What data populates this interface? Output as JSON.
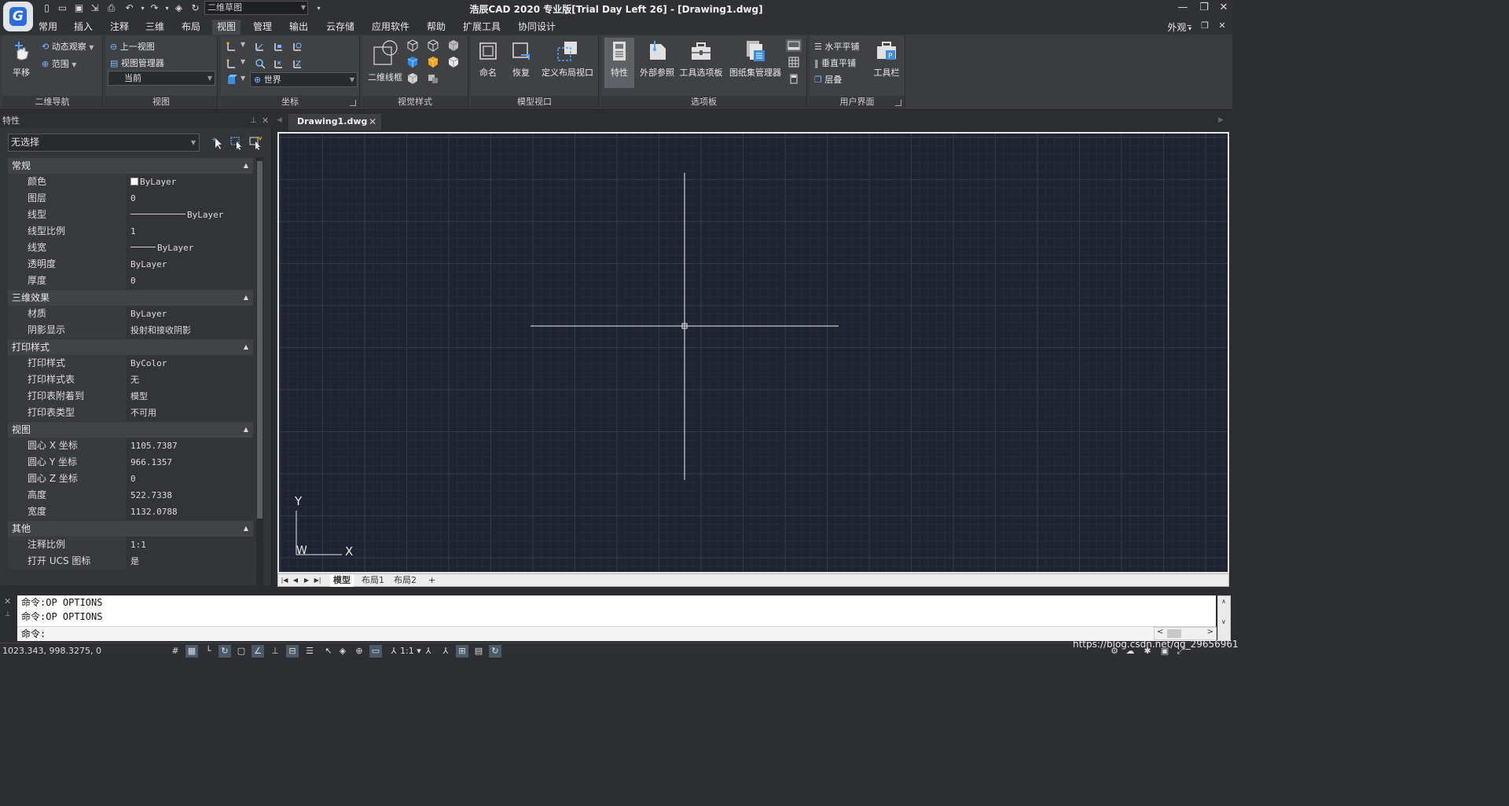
{
  "titlebar": {
    "workspace": "二维草图",
    "title": "浩辰CAD 2020 专业版[Trial Day Left 26] - [Drawing1.dwg]",
    "minimize": "—",
    "restore": "❐",
    "close": "✕"
  },
  "menubar": {
    "items": [
      {
        "label": "常用"
      },
      {
        "label": "插入"
      },
      {
        "label": "注释"
      },
      {
        "label": "三维"
      },
      {
        "label": "布局"
      },
      {
        "label": "视图"
      },
      {
        "label": "管理"
      },
      {
        "label": "输出"
      },
      {
        "label": "云存储"
      },
      {
        "label": "应用软件"
      },
      {
        "label": "帮助"
      },
      {
        "label": "扩展工具"
      },
      {
        "label": "协同设计"
      }
    ],
    "appearance": "外观",
    "active_color": "#45484c"
  },
  "ribbon": {
    "nav2d": {
      "title": "二维导航",
      "pan": "平移",
      "orbit": "动态观察",
      "extents": "范围"
    },
    "view": {
      "title": "视图",
      "prev_view": "上一视图",
      "view_manager": "视图管理器",
      "current": "当前"
    },
    "coords": {
      "title": "坐标",
      "world": "世界"
    },
    "visual_styles": {
      "title": "视觉样式",
      "wireframe": "二维线框"
    },
    "model_viewports": {
      "title": "模型视口",
      "named": "命名",
      "restore": "恢复",
      "define": "定义布局视口"
    },
    "palettes": {
      "title": "选项板",
      "properties": "特性",
      "xref": "外部参照",
      "tool_palettes": "工具选项板",
      "sheet_set": "图纸集管理器"
    },
    "ui": {
      "title": "用户界面",
      "tile_h": "水平平铺",
      "tile_v": "垂直平铺",
      "cascade": "层叠",
      "toolbars": "工具栏"
    }
  },
  "properties": {
    "title": "特性",
    "selection": "无选择",
    "sections": [
      {
        "name": "常规",
        "rows": [
          {
            "key": "颜色",
            "value": "ByLayer",
            "swatch": true
          },
          {
            "key": "图层",
            "value": "0"
          },
          {
            "key": "线型",
            "value": "ByLayer",
            "line": 70
          },
          {
            "key": "线型比例",
            "value": "1"
          },
          {
            "key": "线宽",
            "value": "ByLayer",
            "line": 32
          },
          {
            "key": "透明度",
            "value": "ByLayer"
          },
          {
            "key": "厚度",
            "value": "0"
          }
        ]
      },
      {
        "name": "三维效果",
        "rows": [
          {
            "key": "材质",
            "value": "ByLayer"
          },
          {
            "key": "阴影显示",
            "value": "投射和接收阴影"
          }
        ]
      },
      {
        "name": "打印样式",
        "rows": [
          {
            "key": "打印样式",
            "value": "ByColor"
          },
          {
            "key": "打印样式表",
            "value": "无"
          },
          {
            "key": "打印表附着到",
            "value": "模型"
          },
          {
            "key": "打印表类型",
            "value": "不可用"
          }
        ]
      },
      {
        "name": "视图",
        "rows": [
          {
            "key": "圆心 X 坐标",
            "value": "1105.7387"
          },
          {
            "key": "圆心 Y 坐标",
            "value": "966.1357"
          },
          {
            "key": "圆心 Z 坐标",
            "value": "0"
          },
          {
            "key": "高度",
            "value": "522.7338"
          },
          {
            "key": "宽度",
            "value": "1132.0788"
          }
        ]
      },
      {
        "name": "其他",
        "rows": [
          {
            "key": "注释比例",
            "value": "1:1"
          },
          {
            "key": "打开 UCS 图标",
            "value": "是"
          }
        ]
      }
    ]
  },
  "document": {
    "tab": "Drawing1.dwg",
    "close": "✕"
  },
  "canvas": {
    "background": "#1f2430",
    "ucs_y": "Y",
    "ucs_w": "W",
    "ucs_x": "X"
  },
  "layout_tabs": [
    {
      "label": "模型",
      "active": true
    },
    {
      "label": "布局1"
    },
    {
      "label": "布局2"
    },
    {
      "label": "+"
    }
  ],
  "command": {
    "history": [
      "命令:OP OPTIONS",
      "命令:OP OPTIONS"
    ],
    "prompt": "命令:"
  },
  "status": {
    "coords": "1023.343, 998.3275, 0",
    "scale": "1:1"
  },
  "watermark": "https://blog.csdn.net/qq_29656961"
}
